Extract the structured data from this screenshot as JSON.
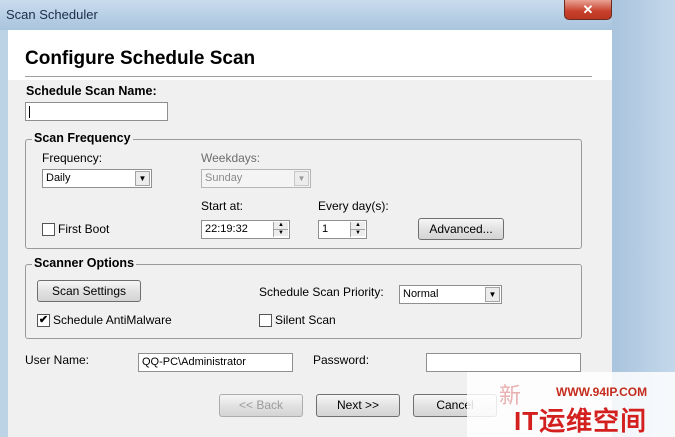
{
  "window": {
    "title": "Scan Scheduler",
    "close_glyph": "✕"
  },
  "page_title": "Configure Schedule Scan",
  "name_section": {
    "label": "Schedule Scan Name:",
    "value": ""
  },
  "frequency_group": {
    "legend": "Scan Frequency",
    "frequency_label": "Frequency:",
    "frequency_value": "Daily",
    "weekdays_label": "Weekdays:",
    "weekdays_value": "Sunday",
    "first_boot_label": "First Boot",
    "first_boot_checked": false,
    "start_at_label": "Start at:",
    "start_at_value": "22:19:32",
    "every_days_label": "Every day(s):",
    "every_days_value": "1",
    "advanced_button": "Advanced..."
  },
  "scanner_group": {
    "legend": "Scanner Options",
    "scan_settings_button": "Scan Settings",
    "priority_label": "Schedule Scan Priority:",
    "priority_value": "Normal",
    "antimalware_label": "Schedule AntiMalware",
    "antimalware_checked": true,
    "silent_scan_label": "Silent Scan",
    "silent_scan_checked": false
  },
  "credentials": {
    "user_name_label": "User Name:",
    "user_name_value": "QQ-PC\\Administrator",
    "password_label": "Password:",
    "password_value": ""
  },
  "footer": {
    "back_button": "<< Back",
    "next_button": "Next >>",
    "cancel_button": "Cancel"
  },
  "watermark": {
    "site": "WWW.94IP.COM",
    "brand": "IT运维空间",
    "partial_char": "新"
  },
  "icons": {
    "dropdown": "▼",
    "spin_up": "▲",
    "spin_down": "▼",
    "check": "✔"
  }
}
